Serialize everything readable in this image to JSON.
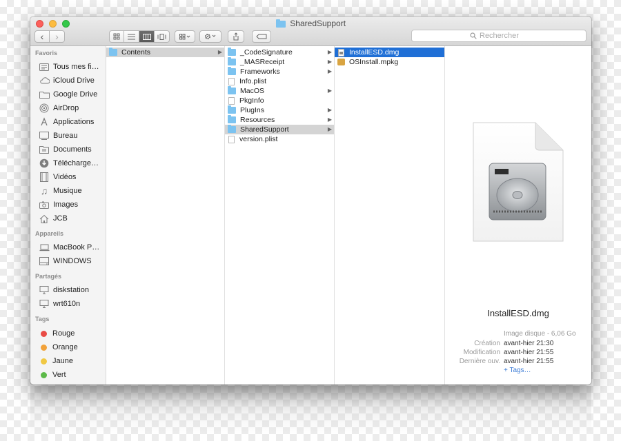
{
  "window": {
    "title": "SharedSupport"
  },
  "toolbar": {
    "back_symbol": "‹",
    "forward_symbol": "›",
    "search_placeholder": "Rechercher"
  },
  "sidebar": {
    "favoris": {
      "title": "Favoris",
      "items": [
        {
          "label": "Tous mes fi…",
          "icon": "all-files-icon"
        },
        {
          "label": "iCloud Drive",
          "icon": "cloud-icon"
        },
        {
          "label": "Google Drive",
          "icon": "folder-icon"
        },
        {
          "label": "AirDrop",
          "icon": "airdrop-icon"
        },
        {
          "label": "Applications",
          "icon": "applications-icon"
        },
        {
          "label": "Bureau",
          "icon": "desktop-icon"
        },
        {
          "label": "Documents",
          "icon": "documents-icon"
        },
        {
          "label": "Télécharge…",
          "icon": "downloads-icon"
        },
        {
          "label": "Vidéos",
          "icon": "movies-icon"
        },
        {
          "label": "Musique",
          "icon": "music-icon"
        },
        {
          "label": "Images",
          "icon": "pictures-icon"
        },
        {
          "label": "JCB",
          "icon": "home-icon"
        }
      ]
    },
    "appareils": {
      "title": "Appareils",
      "items": [
        {
          "label": "MacBook P…",
          "icon": "laptop-icon"
        },
        {
          "label": "WINDOWS",
          "icon": "drive-icon"
        }
      ]
    },
    "partages": {
      "title": "Partagés",
      "items": [
        {
          "label": "diskstation",
          "icon": "server-icon"
        },
        {
          "label": "wrt610n",
          "icon": "server-icon"
        }
      ]
    },
    "tags": {
      "title": "Tags",
      "items": [
        {
          "label": "Rouge",
          "color": "#e94b45"
        },
        {
          "label": "Orange",
          "color": "#f2a23a"
        },
        {
          "label": "Jaune",
          "color": "#f0c843"
        },
        {
          "label": "Vert",
          "color": "#5cb948"
        }
      ]
    }
  },
  "columns": [
    {
      "items": [
        {
          "name": "Contents",
          "type": "folder",
          "has_children": true,
          "selected": "grey"
        }
      ]
    },
    {
      "items": [
        {
          "name": "_CodeSignature",
          "type": "folder",
          "has_children": true
        },
        {
          "name": "_MASReceipt",
          "type": "folder",
          "has_children": true
        },
        {
          "name": "Frameworks",
          "type": "folder",
          "has_children": true
        },
        {
          "name": "Info.plist",
          "type": "file"
        },
        {
          "name": "MacOS",
          "type": "folder",
          "has_children": true
        },
        {
          "name": "PkgInfo",
          "type": "file"
        },
        {
          "name": "PlugIns",
          "type": "folder",
          "has_children": true
        },
        {
          "name": "Resources",
          "type": "folder",
          "has_children": true
        },
        {
          "name": "SharedSupport",
          "type": "folder",
          "has_children": true,
          "selected": "grey"
        },
        {
          "name": "version.plist",
          "type": "file"
        }
      ]
    },
    {
      "items": [
        {
          "name": "InstallESD.dmg",
          "type": "dmg",
          "selected": "blue"
        },
        {
          "name": "OSInstall.mpkg",
          "type": "pkg"
        }
      ]
    }
  ],
  "preview": {
    "name": "InstallESD.dmg",
    "kind": "Image disque - 6,06 Go",
    "creation_label": "Création",
    "creation_value": "avant-hier 21:30",
    "modification_label": "Modification",
    "modification_value": "avant-hier 21:55",
    "last_opened_label": "Dernière ouv.",
    "last_opened_value": "avant-hier 21:55",
    "tags_link": "+ Tags…"
  },
  "colors": {
    "selection_blue": "#1f6fd6",
    "selection_grey": "#d4d4d4",
    "folder_blue": "#7cc3f0"
  }
}
